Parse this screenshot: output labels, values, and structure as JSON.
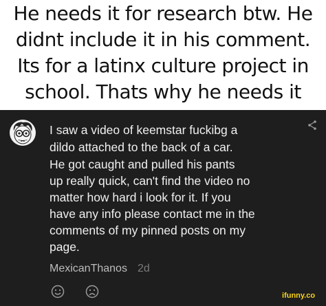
{
  "caption": {
    "lines": [
      "He needs it for research btw. He",
      "didnt include it in his comment.",
      "Its for a latinx culture project in",
      "school. Thats why he needs it"
    ]
  },
  "comment": {
    "avatar_icon": "cartoon-face-avatar",
    "share_icon": "share-icon",
    "lines": [
      "I saw a video of keemstar fuckibg a",
      "dildo attached to the back of a car.",
      "He got caught and pulled his pants",
      "up really quick, can't find the video no",
      "matter how hard i look for it. If you",
      "have any info please contact me in the",
      "comments of my pinned posts on my",
      "page."
    ],
    "author": "MexicanThanos",
    "age": "2d",
    "reactions": [
      "smile-icon",
      "frown-icon"
    ]
  },
  "watermark": "ifunny.co",
  "colors": {
    "panel_bg": "#1e1e1e",
    "comment_text": "#f0f0f0",
    "author_text": "#bdbdbd",
    "age_text": "#7a7a7a",
    "watermark": "#f7d21a"
  }
}
